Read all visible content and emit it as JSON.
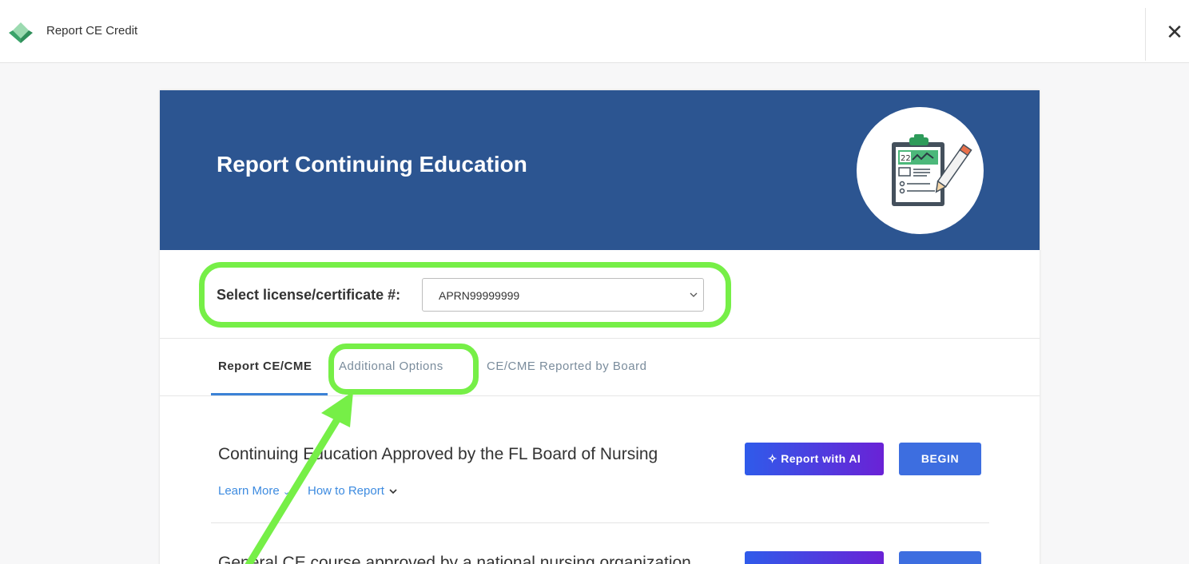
{
  "topbar": {
    "title": "Report CE Credit",
    "close_label": "✕"
  },
  "hero": {
    "title": "Report Continuing Education",
    "illustration_day": "22"
  },
  "license": {
    "label": "Select license/certificate #:",
    "selected": "APRN99999999"
  },
  "tabs": [
    {
      "label": "Report CE/CME",
      "active": true
    },
    {
      "label": "Additional Options",
      "active": false
    },
    {
      "label": "CE/CME Reported by Board",
      "active": false
    }
  ],
  "items": [
    {
      "title": "Continuing Education Approved by the FL Board of Nursing",
      "learn_more": "Learn More",
      "how_to_report": "How to Report",
      "ai_label": "Report with AI",
      "begin_label": "BEGIN"
    },
    {
      "title": "General CE course approved by a national nursing organization"
    }
  ],
  "colors": {
    "header": "#2c5591",
    "highlight": "#76ef47",
    "link": "#3d8be0",
    "begin": "#3d6ee0"
  }
}
